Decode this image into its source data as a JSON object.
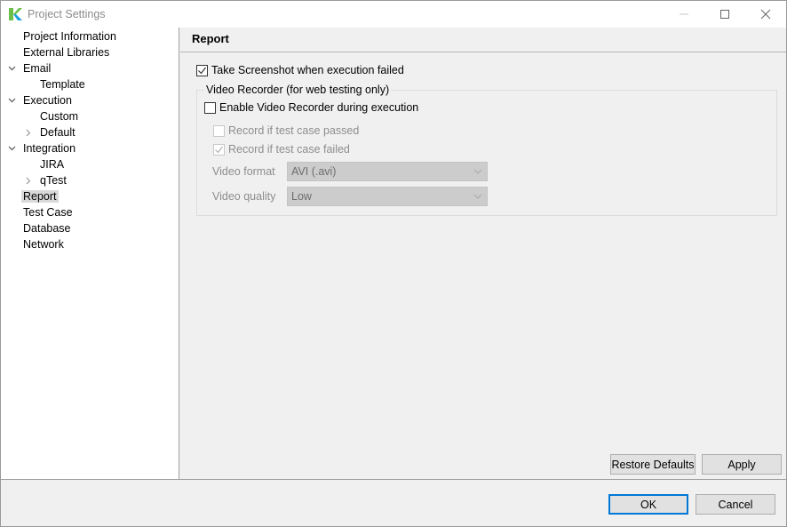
{
  "window": {
    "title": "Project Settings",
    "brand_colors": {
      "logo_green": "#6cc04a",
      "logo_blue": "#1ba1e2"
    },
    "controls": [
      "minimize-icon",
      "maximize-icon",
      "close-icon"
    ]
  },
  "sidebar": {
    "items": [
      {
        "label": "Project Information",
        "level": 0,
        "expander": "none",
        "selected": false
      },
      {
        "label": "External Libraries",
        "level": 0,
        "expander": "none",
        "selected": false
      },
      {
        "label": "Email",
        "level": 0,
        "expander": "expanded",
        "selected": false
      },
      {
        "label": "Template",
        "level": 1,
        "expander": "none",
        "selected": false
      },
      {
        "label": "Execution",
        "level": 0,
        "expander": "expanded",
        "selected": false
      },
      {
        "label": "Custom",
        "level": 1,
        "expander": "none",
        "selected": false
      },
      {
        "label": "Default",
        "level": 1,
        "expander": "collapsed",
        "selected": false
      },
      {
        "label": "Integration",
        "level": 0,
        "expander": "expanded",
        "selected": false
      },
      {
        "label": "JIRA",
        "level": 1,
        "expander": "none",
        "selected": false
      },
      {
        "label": "qTest",
        "level": 1,
        "expander": "collapsed",
        "selected": false
      },
      {
        "label": "Report",
        "level": 0,
        "expander": "none",
        "selected": true
      },
      {
        "label": "Test Case",
        "level": 0,
        "expander": "none",
        "selected": false
      },
      {
        "label": "Database",
        "level": 0,
        "expander": "none",
        "selected": false
      },
      {
        "label": "Network",
        "level": 0,
        "expander": "none",
        "selected": false
      }
    ]
  },
  "main": {
    "title": "Report",
    "take_screenshot": {
      "label": "Take Screenshot when execution failed",
      "checked": true
    },
    "video_group": {
      "title": "Video Recorder (for web testing only)",
      "enable": {
        "label": "Enable Video Recorder during execution",
        "checked": false
      },
      "record_passed": {
        "label": "Record if test case passed",
        "checked": false,
        "enabled": false
      },
      "record_failed": {
        "label": "Record if test case failed",
        "checked": true,
        "enabled": false
      },
      "video_format": {
        "label": "Video format",
        "value": "AVI (.avi)",
        "enabled": false
      },
      "video_quality": {
        "label": "Video quality",
        "value": "Low",
        "enabled": false
      }
    },
    "restore_defaults_label": "Restore Defaults",
    "apply_label": "Apply"
  },
  "footer": {
    "ok_label": "OK",
    "cancel_label": "Cancel",
    "accent": "#0078d7"
  }
}
